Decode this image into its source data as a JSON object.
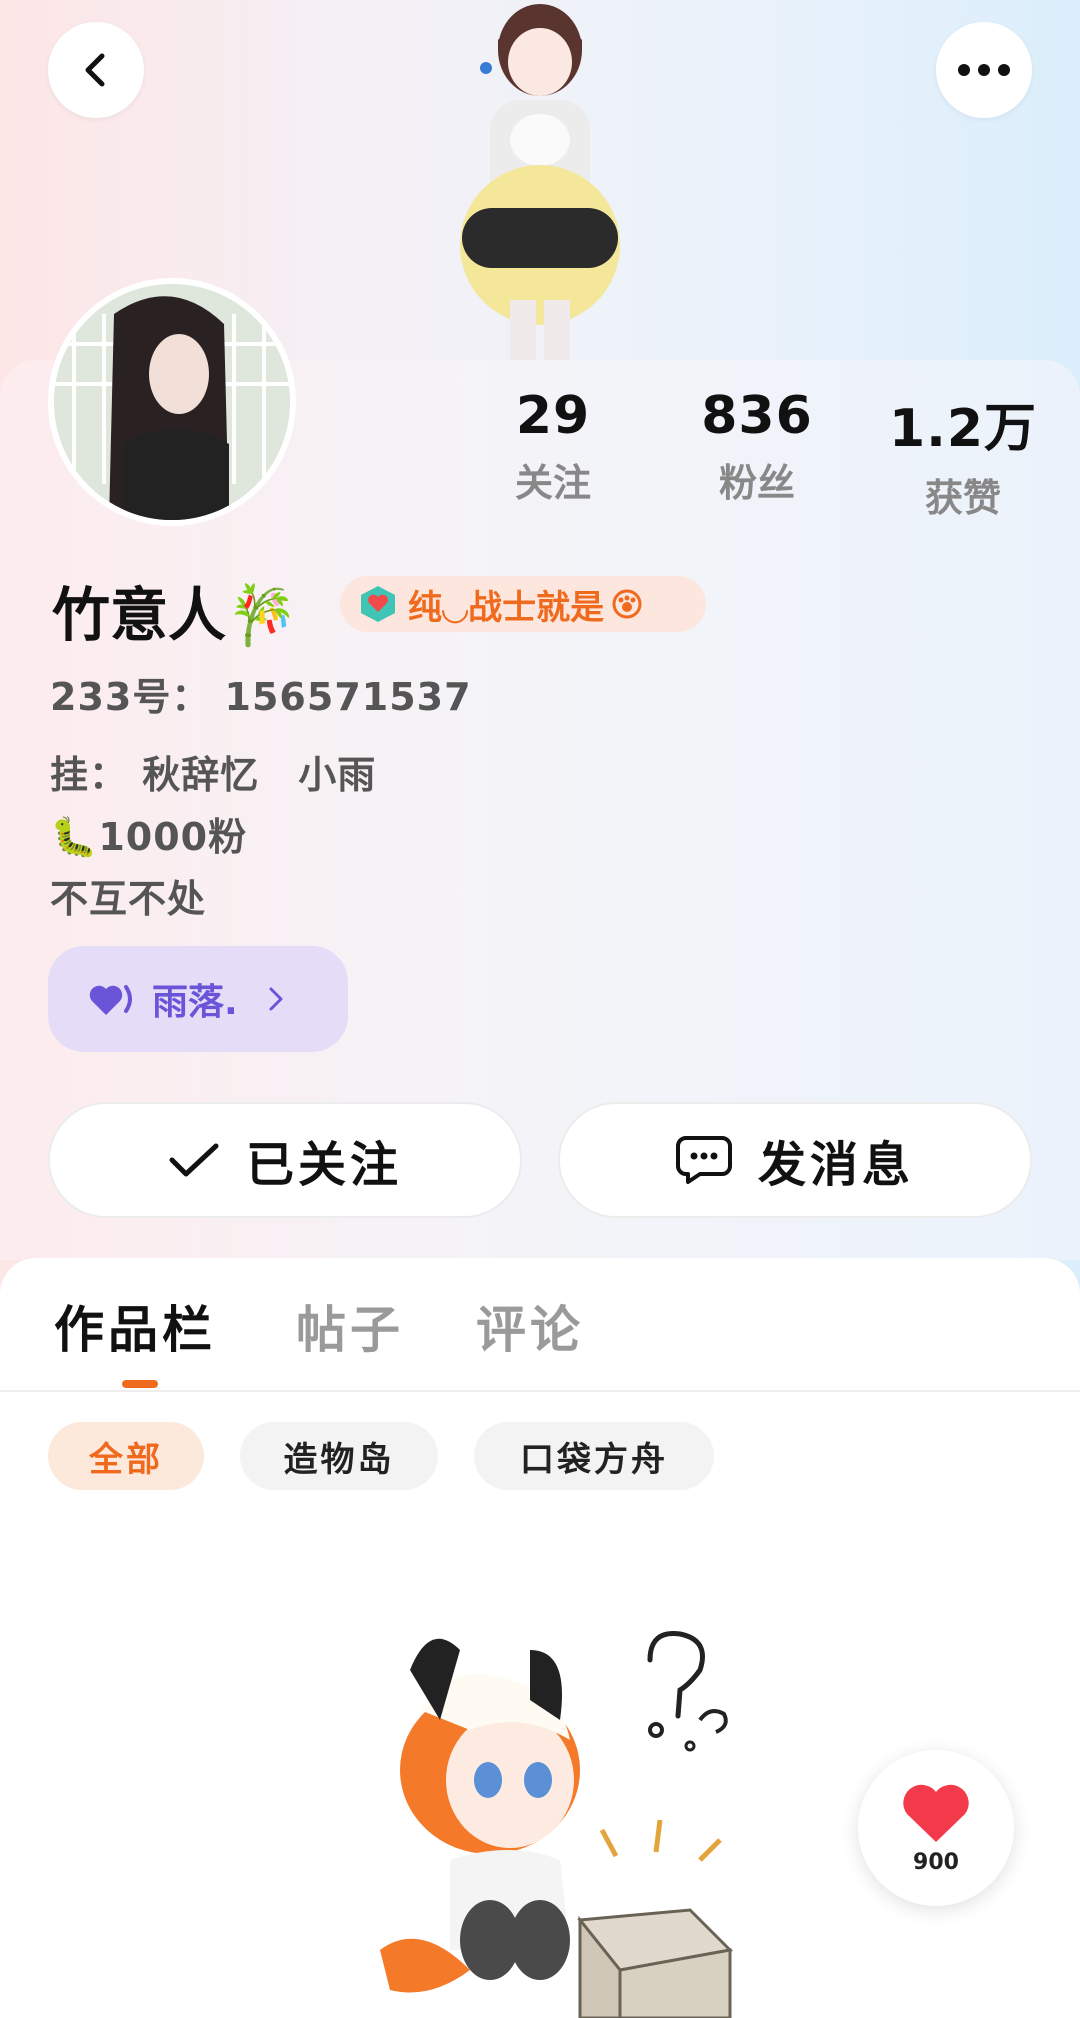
{
  "header": {
    "back_icon": "chevron-left-icon",
    "more_icon": "more-dots-icon"
  },
  "stats": [
    {
      "value": "29",
      "label": "关注"
    },
    {
      "value": "836",
      "label": "粉丝"
    },
    {
      "value": "1.2万",
      "label": "获赞"
    }
  ],
  "profile": {
    "name": "竹意人",
    "name_emoji": "🎋",
    "badge_text": "纯◡战士就是",
    "id_line": "233号： 156571537",
    "bio_lines": [
      "挂： 秋辞忆　小雨",
      "🐛1000粉",
      "不互不处"
    ]
  },
  "relation_tag": {
    "label": "雨落."
  },
  "actions": {
    "follow_label": "已关注",
    "message_label": "发消息"
  },
  "tabs": [
    {
      "label": "作品栏",
      "active": true
    },
    {
      "label": "帖子",
      "active": false
    },
    {
      "label": "评论",
      "active": false
    }
  ],
  "filters": [
    {
      "label": "全部",
      "active": true
    },
    {
      "label": "造物岛",
      "active": false
    },
    {
      "label": "口袋方舟",
      "active": false
    }
  ],
  "like": {
    "count": "900"
  },
  "colors": {
    "accent": "#f06a1e",
    "tag_purple": "#6a55d8",
    "heart_red": "#f23a4a"
  }
}
